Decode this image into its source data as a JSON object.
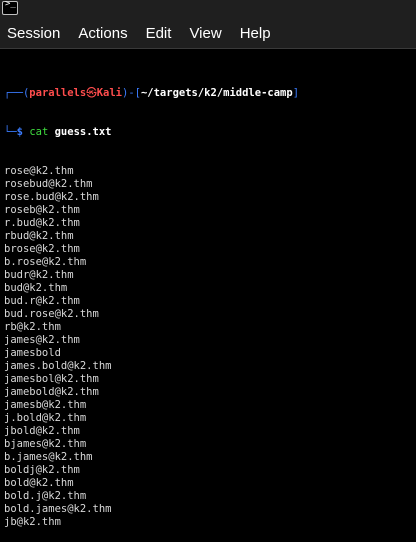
{
  "menu": {
    "items": [
      "Session",
      "Actions",
      "Edit",
      "View",
      "Help"
    ]
  },
  "colors": {
    "prompt_bracket": "#3b7cff",
    "user_host": "#ff4d4d",
    "path": "#ffffff",
    "command": "#3fdc3f",
    "background": "#000000"
  },
  "prompt": {
    "corner_top": "┌──(",
    "user": "parallels",
    "at_symbol": "㉿",
    "host": "Kali",
    "bracket_mid": ")-[",
    "path": "~/targets/k2/middle-camp",
    "bracket_end": "]",
    "corner_bottom": "└─",
    "dollar": "$",
    "command": "cat",
    "argument": "guess.txt"
  },
  "output_lines": [
    "rose@k2.thm",
    "rosebud@k2.thm",
    "rose.bud@k2.thm",
    "roseb@k2.thm",
    "r.bud@k2.thm",
    "rbud@k2.thm",
    "brose@k2.thm",
    "b.rose@k2.thm",
    "budr@k2.thm",
    "bud@k2.thm",
    "bud.r@k2.thm",
    "bud.rose@k2.thm",
    "rb@k2.thm",
    "james@k2.thm",
    "jamesbold",
    "james.bold@k2.thm",
    "jamesbol@k2.thm",
    "jamebold@k2.thm",
    "jamesb@k2.thm",
    "j.bold@k2.thm",
    "jbold@k2.thm",
    "bjames@k2.thm",
    "b.james@k2.thm",
    "boldj@k2.thm",
    "bold@k2.thm",
    "bold.j@k2.thm",
    "bold.james@k2.thm",
    "jb@k2.thm"
  ]
}
